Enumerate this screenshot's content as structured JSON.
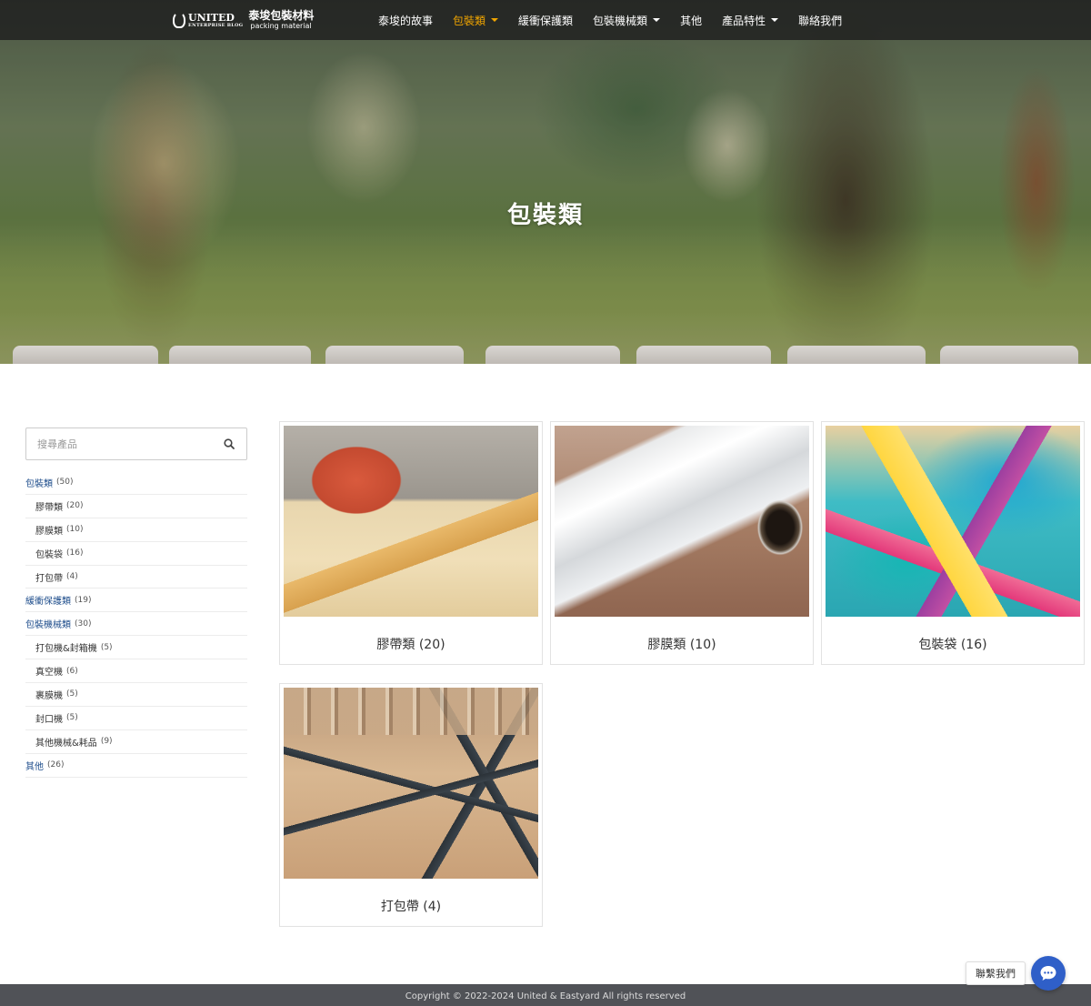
{
  "brand": {
    "logo_en": "UNITED",
    "logo_en_sub": "ENTERPRISE BLOG",
    "logo_zh": "泰埈包裝材料",
    "logo_tagline": "packing material"
  },
  "nav": {
    "items": [
      {
        "label": "泰埈的故事",
        "active": false,
        "dropdown": false
      },
      {
        "label": "包裝類",
        "active": true,
        "dropdown": true
      },
      {
        "label": "緩衝保護類",
        "active": false,
        "dropdown": false
      },
      {
        "label": "包裝機械類",
        "active": false,
        "dropdown": true
      },
      {
        "label": "其他",
        "active": false,
        "dropdown": false
      },
      {
        "label": "產品特性",
        "active": false,
        "dropdown": true
      },
      {
        "label": "聯絡我們",
        "active": false,
        "dropdown": false
      }
    ],
    "active_color": "#f0a500"
  },
  "hero": {
    "title": "包裝類"
  },
  "search": {
    "placeholder": "搜尋產品",
    "value": "",
    "icon": "search-icon"
  },
  "categories": [
    {
      "name": "包裝類",
      "count": "(50)",
      "level": "top"
    },
    {
      "name": "膠帶類",
      "count": "(20)",
      "level": "sub"
    },
    {
      "name": "膠膜類",
      "count": "(10)",
      "level": "sub"
    },
    {
      "name": "包裝袋",
      "count": "(16)",
      "level": "sub"
    },
    {
      "name": "打包帶",
      "count": "(4)",
      "level": "sub"
    },
    {
      "name": "緩衝保護類",
      "count": "(19)",
      "level": "top"
    },
    {
      "name": "包裝機械類",
      "count": "(30)",
      "level": "top"
    },
    {
      "name": "打包機&封箱機",
      "count": "(5)",
      "level": "sub"
    },
    {
      "name": "真空機",
      "count": "(6)",
      "level": "sub"
    },
    {
      "name": "裹膜機",
      "count": "(5)",
      "level": "sub"
    },
    {
      "name": "封口機",
      "count": "(5)",
      "level": "sub"
    },
    {
      "name": "其他機械&耗品",
      "count": "(9)",
      "level": "sub"
    },
    {
      "name": "其他",
      "count": "(26)",
      "level": "top"
    }
  ],
  "products": [
    {
      "label": "膠帶類 (20)",
      "image": "tape-dispenser-photo"
    },
    {
      "label": "膠膜類 (10)",
      "image": "stretch-film-roll-photo"
    },
    {
      "label": "包裝袋 (16)",
      "image": "colorful-plastic-bags-photo"
    },
    {
      "label": "打包帶 (4)",
      "image": "strapped-pallet-photo"
    }
  ],
  "contact": {
    "label": "聯繫我們",
    "icon": "chat-icon",
    "color": "#2f5fc8"
  },
  "footer": {
    "copyright": "Copyright © 2022-2024 United & Eastyard All rights reserved"
  }
}
